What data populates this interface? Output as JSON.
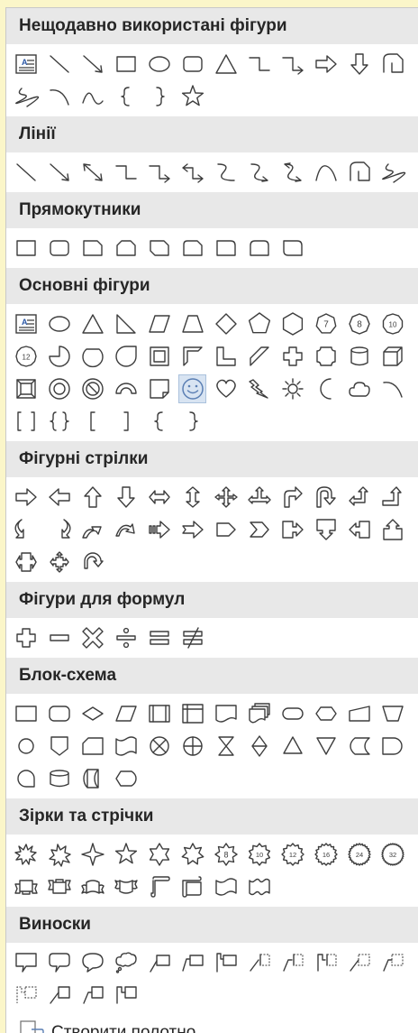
{
  "accent_color": "#5b7fb4",
  "sections": [
    {
      "title": "Нещодавно використані фігури",
      "rows": [
        [
          "text-box",
          "line",
          "line-arrow",
          "rectangle",
          "oval",
          "rounded-rectangle",
          "triangle",
          "elbow-connector",
          "elbow-arrow-connector",
          "right-arrow",
          "down-arrow",
          "curve-freeform"
        ],
        [
          "scribble",
          "arc",
          "arc-curve",
          "left-brace",
          "right-brace",
          "star5"
        ]
      ]
    },
    {
      "title": "Лінії",
      "rows": [
        [
          "line",
          "line-arrow",
          "line-double-arrow",
          "elbow-connector",
          "elbow-arrow-connector",
          "elbow-double-arrow",
          "curved-connector",
          "curved-arrow-connector",
          "curved-double-arrow",
          "curve",
          "freeform",
          "scribble"
        ]
      ]
    },
    {
      "title": "Прямокутники",
      "rows": [
        [
          "rectangle",
          "rounded-rectangle",
          "snip-single",
          "snip-same-side",
          "snip-diagonal",
          "snip-round",
          "round-single",
          "round-same-side",
          "round-diagonal"
        ]
      ]
    },
    {
      "title": "Основні фігури",
      "rows": [
        [
          "text-box",
          "oval",
          "triangle",
          "right-triangle",
          "parallelogram",
          "trapezoid",
          "diamond",
          "pentagon",
          "hexagon",
          "heptagon-7",
          "octagon-8",
          "decagon-10"
        ],
        [
          "dodecagon-12",
          "pie",
          "chord",
          "teardrop",
          "frame",
          "half-frame",
          "l-shape",
          "diagonal-stripe",
          "cross",
          "plaque",
          "can",
          "cube"
        ],
        [
          "bevel",
          "donut",
          "no-symbol",
          "block-arc",
          "folded-corner",
          "smiley-face",
          "heart",
          "lightning-bolt",
          "sun",
          "moon",
          "cloud",
          "arc"
        ],
        [
          "double-bracket",
          "double-brace",
          "left-bracket",
          "right-bracket",
          "left-brace",
          "right-brace"
        ]
      ]
    },
    {
      "title": "Фігурні стрілки",
      "rows": [
        [
          "right-arrow",
          "left-arrow",
          "up-arrow",
          "down-arrow",
          "left-right-arrow",
          "up-down-arrow",
          "quad-arrow",
          "left-right-up-arrow",
          "bent-arrow",
          "u-turn-arrow",
          "left-up-arrow",
          "bent-up-arrow"
        ],
        [
          "curved-right-arrow",
          "curved-left-arrow",
          "curved-up-arrow",
          "curved-down-arrow",
          "striped-right-arrow",
          "notched-right-arrow",
          "pentagon-arrow",
          "chevron",
          "right-arrow-callout",
          "down-arrow-callout",
          "left-arrow-callout",
          "up-arrow-callout"
        ],
        [
          "left-right-arrow-callout",
          "quad-arrow-callout",
          "circular-arrow"
        ]
      ]
    },
    {
      "title": "Фігури для формул",
      "rows": [
        [
          "plus",
          "minus",
          "multiply",
          "divide",
          "equal",
          "not-equal"
        ]
      ]
    },
    {
      "title": "Блок-схема",
      "rows": [
        [
          "process",
          "alternate-process",
          "decision",
          "data",
          "predefined-process",
          "internal-storage",
          "document",
          "multidocument",
          "terminator",
          "preparation",
          "manual-input",
          "manual-operation"
        ],
        [
          "connector",
          "offpage-connector",
          "card",
          "punched-tape",
          "summing-junction",
          "or",
          "collate",
          "sort",
          "extract",
          "merge",
          "stored-data",
          "delay"
        ],
        [
          "sequential-access",
          "magnetic-disk",
          "direct-access",
          "display"
        ]
      ]
    },
    {
      "title": "Зірки та стрічки",
      "rows": [
        [
          "explosion1",
          "explosion2",
          "star4",
          "star5",
          "star6",
          "star7",
          "star8",
          "star10",
          "star12",
          "star16",
          "star24",
          "star32"
        ],
        [
          "ribbon-up",
          "ribbon-down",
          "curved-ribbon-up",
          "curved-ribbon-down",
          "vertical-scroll",
          "horizontal-scroll",
          "wave",
          "double-wave"
        ]
      ]
    },
    {
      "title": "Виноски",
      "rows": [
        [
          "rect-callout",
          "rounded-rect-callout",
          "oval-callout",
          "cloud-callout",
          "line-callout1",
          "line-callout2",
          "line-callout3",
          "line-callout-accent1",
          "line-callout-accent2",
          "line-callout-accent3",
          "line-callout-nb1",
          "line-callout-nb2"
        ],
        [
          "line-callout-nb3",
          "line-callout-border1",
          "line-callout-border2",
          "line-callout-border3"
        ]
      ]
    }
  ],
  "selected_shape": "smiley-face",
  "footer": {
    "icon": "drawing-canvas-icon",
    "label_first": "С",
    "label_rest": "творити полотно"
  }
}
